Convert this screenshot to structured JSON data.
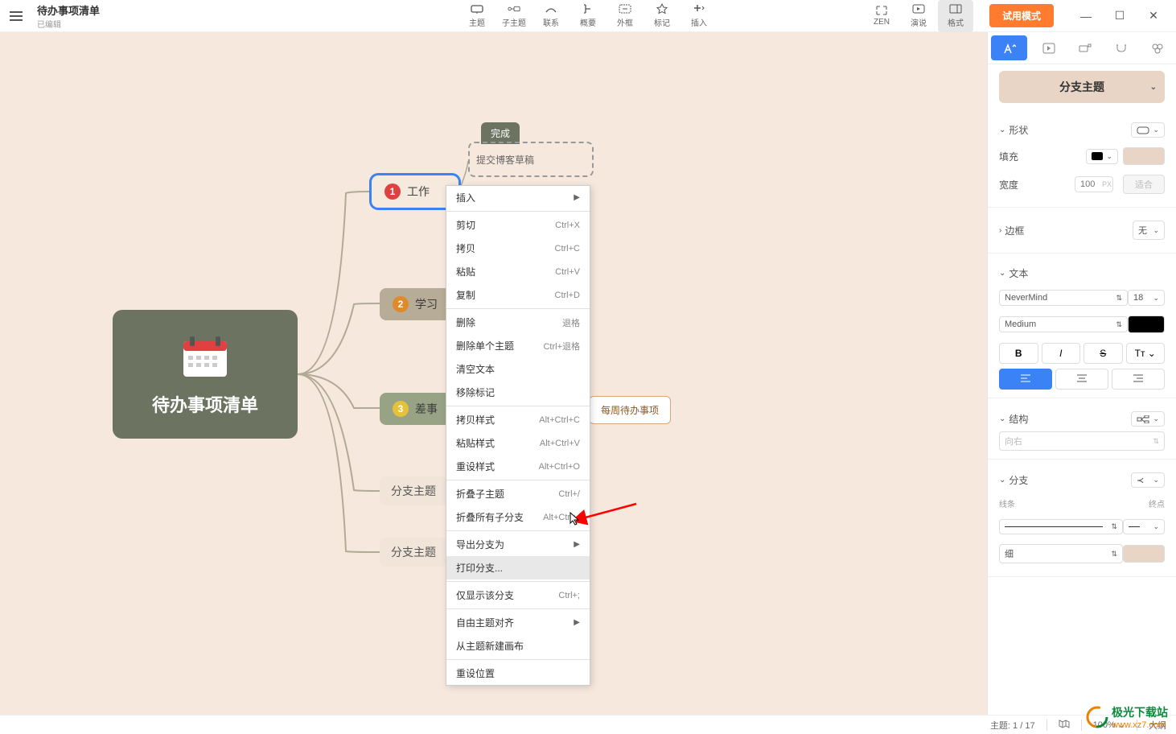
{
  "header": {
    "title": "待办事项清单",
    "subtitle": "已编辑",
    "toolbar": [
      {
        "label": "主题",
        "icon": "topic"
      },
      {
        "label": "子主题",
        "icon": "subtopic"
      },
      {
        "label": "联系",
        "icon": "relation"
      },
      {
        "label": "概要",
        "icon": "summary"
      },
      {
        "label": "外框",
        "icon": "boundary"
      },
      {
        "label": "标记",
        "icon": "marker"
      },
      {
        "label": "插入",
        "icon": "insert"
      }
    ],
    "right_tools": [
      {
        "label": "ZEN",
        "icon": "zen"
      },
      {
        "label": "演说",
        "icon": "present"
      },
      {
        "label": "格式",
        "icon": "format",
        "active": true
      }
    ],
    "trial_btn": "试用模式"
  },
  "mindmap": {
    "central": "待办事项清单",
    "done_tag": "完成",
    "done_text": "提交博客草稿",
    "nodes": [
      {
        "badge": "1",
        "badge_color": "#e04040",
        "text": "工作"
      },
      {
        "badge": "2",
        "badge_color": "#e08a2a",
        "text": "学习"
      },
      {
        "badge": "3",
        "badge_color": "#e4c23a",
        "text": "差事"
      }
    ],
    "branch_nodes": [
      "分支主题",
      "分支主题"
    ],
    "weekly": "每周待办事项"
  },
  "context_menu": {
    "items": [
      {
        "label": "插入",
        "type": "submenu"
      },
      {
        "type": "sep"
      },
      {
        "label": "剪切",
        "shortcut": "Ctrl+X"
      },
      {
        "label": "拷贝",
        "shortcut": "Ctrl+C"
      },
      {
        "label": "粘贴",
        "shortcut": "Ctrl+V"
      },
      {
        "label": "复制",
        "shortcut": "Ctrl+D"
      },
      {
        "type": "sep"
      },
      {
        "label": "删除",
        "shortcut": "退格"
      },
      {
        "label": "删除单个主题",
        "shortcut": "Ctrl+退格"
      },
      {
        "label": "清空文本",
        "shortcut": ""
      },
      {
        "label": "移除标记",
        "shortcut": ""
      },
      {
        "type": "sep"
      },
      {
        "label": "拷贝样式",
        "shortcut": "Alt+Ctrl+C"
      },
      {
        "label": "粘贴样式",
        "shortcut": "Alt+Ctrl+V"
      },
      {
        "label": "重设样式",
        "shortcut": "Alt+Ctrl+O"
      },
      {
        "type": "sep"
      },
      {
        "label": "折叠子主题",
        "shortcut": "Ctrl+/"
      },
      {
        "label": "折叠所有子分支",
        "shortcut": "Alt+Ctrl+/"
      },
      {
        "type": "sep"
      },
      {
        "label": "导出分支为",
        "type": "submenu"
      },
      {
        "label": "打印分支...",
        "hover": true
      },
      {
        "type": "sep"
      },
      {
        "label": "仅显示该分支",
        "shortcut": "Ctrl+;"
      },
      {
        "type": "sep"
      },
      {
        "label": "自由主题对齐",
        "type": "submenu"
      },
      {
        "label": "从主题新建画布",
        "shortcut": ""
      },
      {
        "type": "sep"
      },
      {
        "label": "重设位置",
        "shortcut": ""
      }
    ]
  },
  "side_panel": {
    "header_btn": "分支主题",
    "sections": {
      "shape": {
        "title": "形状",
        "fill_label": "填充",
        "fill_color": "#000000",
        "shape_color": "#e8d5c5",
        "width_label": "宽度",
        "width_value": "100",
        "width_unit": "PX",
        "fit_btn": "适合"
      },
      "border": {
        "title": "边框",
        "value": "无"
      },
      "text": {
        "title": "文本",
        "font": "NeverMind",
        "size": "18",
        "weight": "Medium",
        "color": "#000000"
      },
      "structure": {
        "title": "结构",
        "direction": "向右"
      },
      "branch": {
        "title": "分支",
        "line_label": "线条",
        "end_label": "终点",
        "thickness": "细",
        "color": "#e8d5c5"
      }
    }
  },
  "status_bar": {
    "topic": "主题: 1 / 17",
    "zoom": "100%",
    "outline": "大纲"
  },
  "watermark": {
    "text": "极光下载站",
    "url": "www.xz7.com"
  }
}
